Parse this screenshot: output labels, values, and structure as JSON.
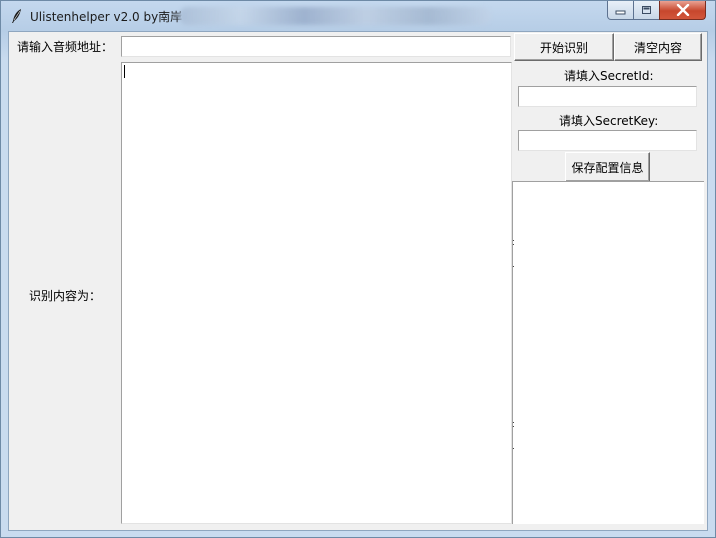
{
  "window": {
    "title": "Ulistenhelper v2.0 by南岸"
  },
  "form": {
    "audio_url_label": "请输入音频地址：",
    "audio_url_value": "",
    "start_button": "开始识别",
    "clear_button": "清空内容",
    "result_label": "识别内容为：",
    "result_text": "",
    "secret_id_label": "请填入SecretId:",
    "secret_id_value": "",
    "secret_key_label": "请填入SecretKey:",
    "secret_key_value": "",
    "save_button": "保存配置信息"
  },
  "icons": {
    "app": "feather-icon",
    "minimize": "minimize-icon",
    "maximize": "maximize-icon",
    "close": "close-icon"
  }
}
